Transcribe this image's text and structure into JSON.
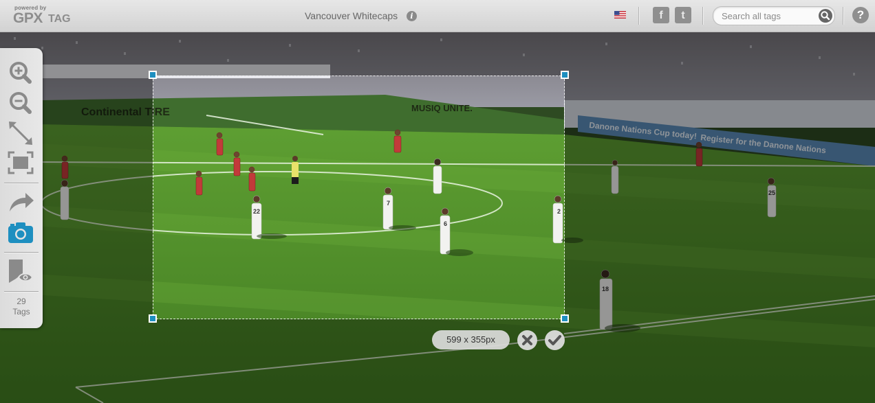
{
  "header": {
    "powered_by": "powered by",
    "logo_gpx": "GPX",
    "logo_tag": "TAG",
    "title": "Vancouver Whitecaps",
    "info_glyph": "i",
    "language_icon": "us-flag-icon",
    "facebook_glyph": "f",
    "twitter_glyph": "t",
    "search": {
      "placeholder": "Search all tags",
      "value": ""
    },
    "help_glyph": "?"
  },
  "toolbar": {
    "tools": [
      "zoom-in-icon",
      "zoom-out-icon",
      "expand-icon",
      "fit-screen-icon",
      "share-icon",
      "camera-icon",
      "tag-visibility-icon"
    ],
    "tags_count": "29",
    "tags_label": "Tags"
  },
  "photo": {
    "board_text_1": "Continental TIRE",
    "board_text_2": "MUSIQ UNITE.",
    "board_text_3": "Danone Nations Cup today!",
    "board_text_4": "Register for the Danone Nations",
    "jersey_numbers": [
      "7",
      "6",
      "22",
      "2",
      "18",
      "25"
    ]
  },
  "crop": {
    "size_label": "599 x 355px",
    "cancel_icon": "close-icon",
    "confirm_icon": "check-icon"
  },
  "colors": {
    "accent": "#1e8fc0",
    "toolbar_icon": "#8a8a8a",
    "camera_active": "#1e8fc0",
    "pitch": "#4f8a2c"
  }
}
